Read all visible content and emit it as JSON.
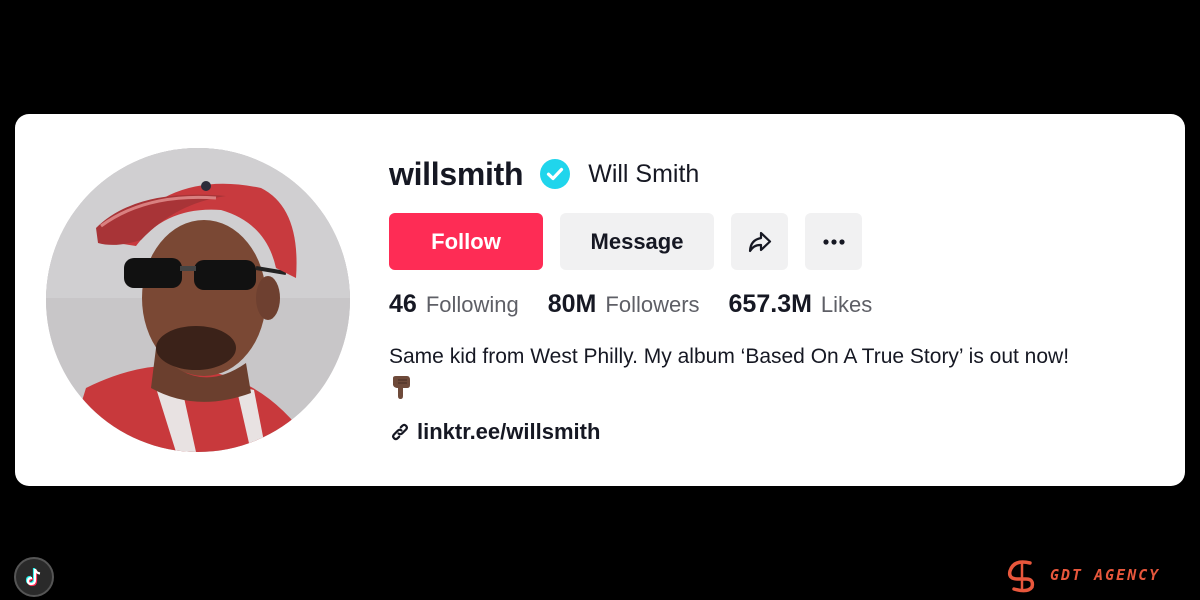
{
  "profile": {
    "username": "willsmith",
    "display_name": "Will Smith",
    "verified": true
  },
  "actions": {
    "follow_label": "Follow",
    "message_label": "Message",
    "share_icon": "share-arrow-icon",
    "more_icon": "more-horizontal-icon"
  },
  "stats": [
    {
      "value": "46",
      "label": "Following"
    },
    {
      "value": "80M",
      "label": "Followers"
    },
    {
      "value": "657.3M",
      "label": "Likes"
    }
  ],
  "bio": {
    "text": "Same kid from West Philly. My album ‘Based On A True Story’ is out now!",
    "emoji": "pointing-down-hand-emoji"
  },
  "link": {
    "text": "linktr.ee/willsmith",
    "icon": "link-icon"
  },
  "watermark": {
    "agency_name": "GDT AGENCY",
    "app_icon": "tiktok-logo-icon"
  },
  "colors": {
    "follow": "#fe2c55",
    "verified": "#20d5ec",
    "text": "#161823",
    "secondary_text": "#5e5f66",
    "button_bg": "#f1f1f2",
    "agency": "#e8573c"
  }
}
